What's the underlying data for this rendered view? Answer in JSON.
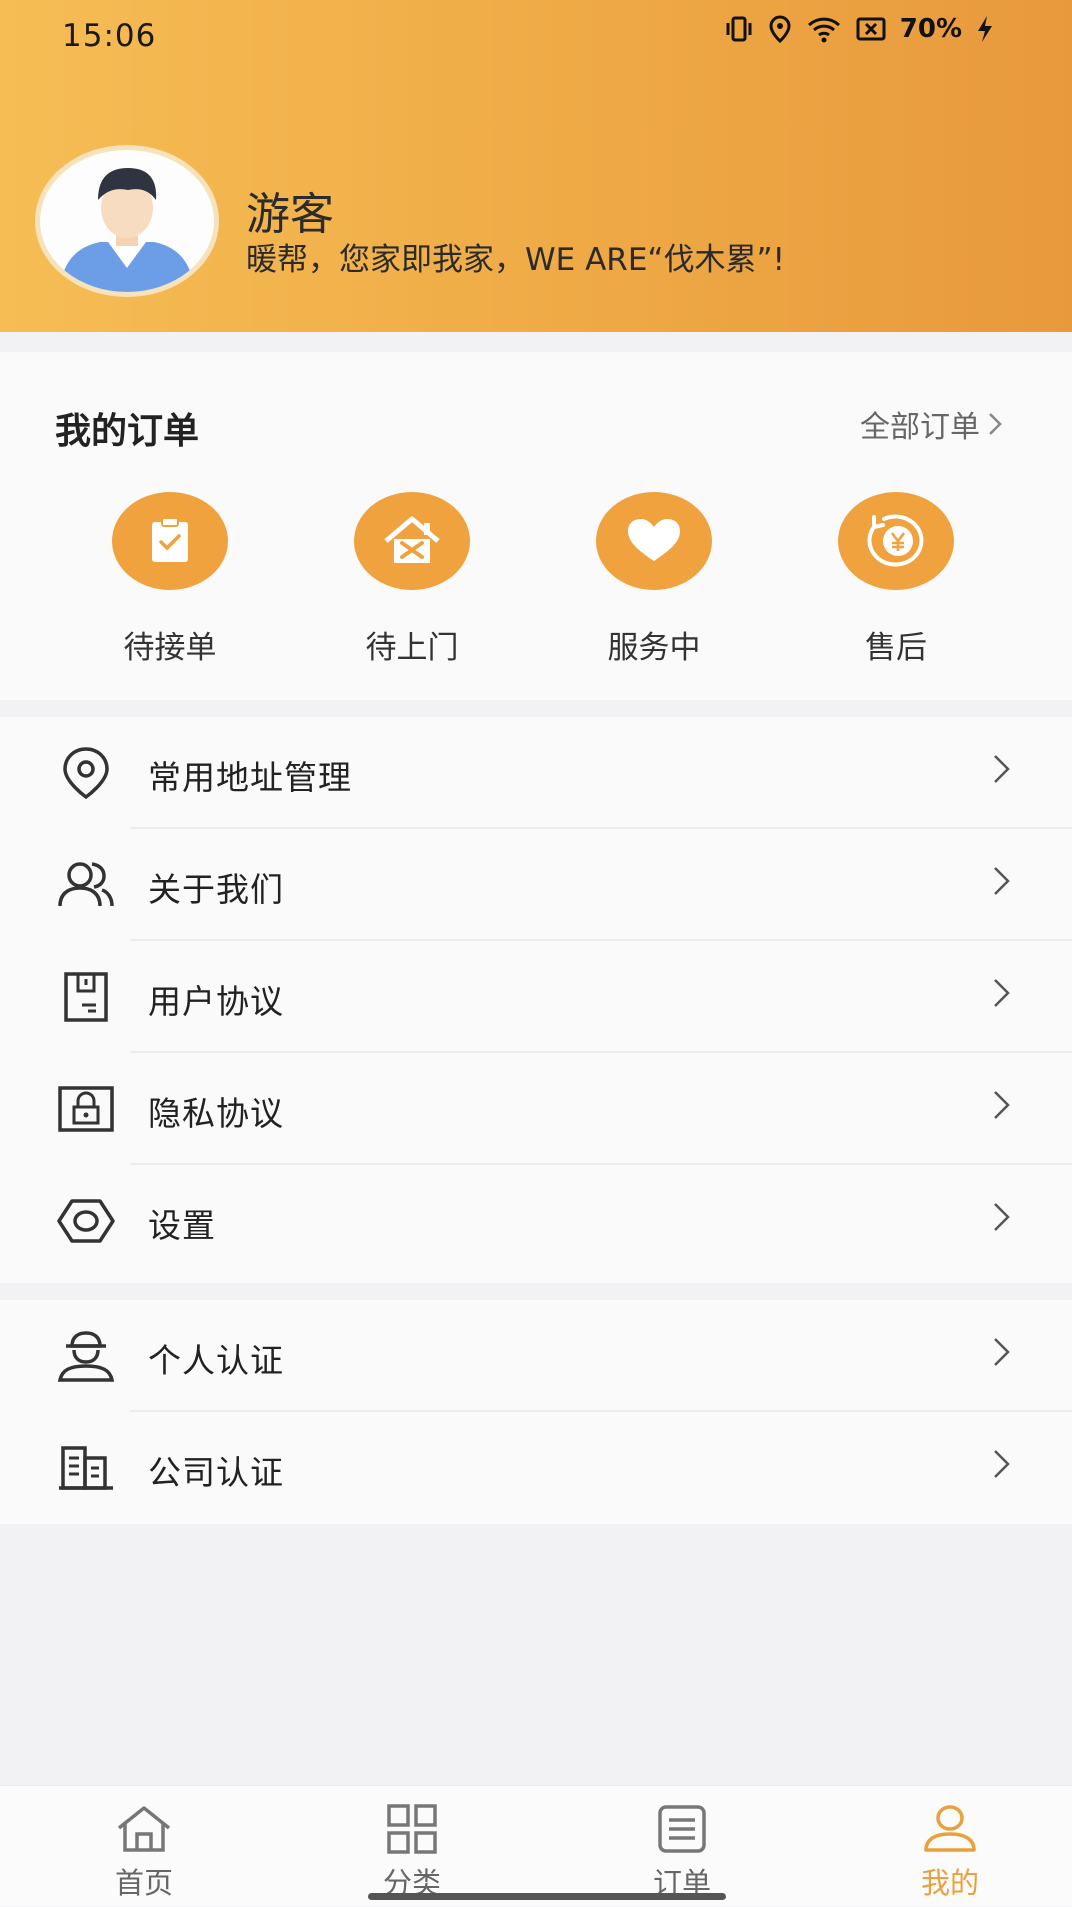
{
  "status_bar": {
    "time": "15:06",
    "battery": "70%"
  },
  "profile": {
    "name": "游客",
    "slogan": "暖帮，您家即我家，WE ARE“伐木累”!"
  },
  "orders": {
    "title": "我的订单",
    "all_link": "全部订单",
    "items": [
      {
        "label": "待接单",
        "icon": "clipboard-check-icon"
      },
      {
        "label": "待上门",
        "icon": "house-tools-icon"
      },
      {
        "label": "服务中",
        "icon": "heart-icon"
      },
      {
        "label": "售后",
        "icon": "yen-coin-icon"
      }
    ]
  },
  "menu": {
    "group1": [
      {
        "label": "常用地址管理",
        "icon": "location-pin-icon"
      },
      {
        "label": "关于我们",
        "icon": "users-icon"
      },
      {
        "label": "用户协议",
        "icon": "document-icon"
      },
      {
        "label": "隐私协议",
        "icon": "lock-icon"
      },
      {
        "label": "设置",
        "icon": "hexagon-settings-icon"
      }
    ],
    "group2": [
      {
        "label": "个人认证",
        "icon": "person-cap-icon"
      },
      {
        "label": "公司认证",
        "icon": "building-icon"
      }
    ]
  },
  "tabbar": {
    "tabs": [
      {
        "label": "首页",
        "icon": "home-icon"
      },
      {
        "label": "分类",
        "icon": "grid-icon"
      },
      {
        "label": "订单",
        "icon": "list-icon"
      },
      {
        "label": "我的",
        "icon": "user-icon",
        "active": true
      }
    ]
  },
  "colors": {
    "accent": "#f0a23f",
    "header_start": "#f6bd55",
    "header_end": "#e8993c"
  }
}
